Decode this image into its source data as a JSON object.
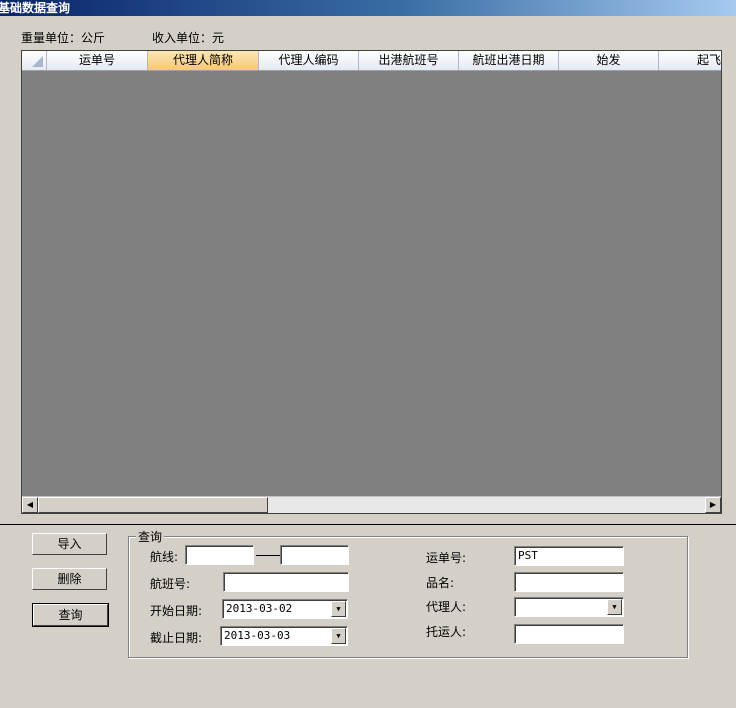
{
  "window": {
    "title": "基础数据查询"
  },
  "units": {
    "weight": "重量单位：公斤",
    "income": "收入单位：元"
  },
  "grid": {
    "columns": [
      "运单号",
      "代理人简称",
      "代理人编码",
      "出港航班号",
      "航班出港日期",
      "始发",
      "起飞"
    ],
    "active_column": 1
  },
  "buttons": {
    "import": "导入",
    "delete": "删除",
    "query": "查询"
  },
  "query": {
    "legend": "查询",
    "route_label": "航线:",
    "route_from": "",
    "route_to": "",
    "flight_no_label": "航班号:",
    "flight_no": "",
    "start_date_label": "开始日期:",
    "start_date": "2013-03-02",
    "end_date_label": "截止日期:",
    "end_date": "2013-03-03",
    "waybill_label": "运单号:",
    "waybill": "PST",
    "product_label": "品名:",
    "product": "",
    "agent_label": "代理人:",
    "agent": "",
    "shipper_label": "托运人:",
    "shipper": ""
  }
}
